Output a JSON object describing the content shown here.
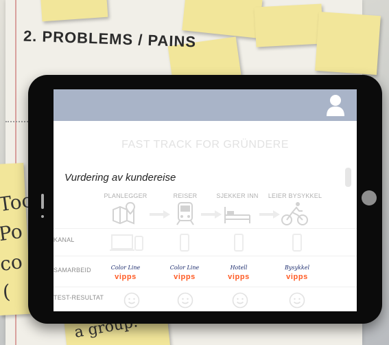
{
  "background": {
    "heading": "2. PROBLEMS / PAINS",
    "notes": [
      "Too",
      "Po",
      "co",
      "(",
      "a group."
    ]
  },
  "app": {
    "title": "FAST TRACK FOR GRÜNDERE",
    "user_icon": "user-icon",
    "section_title": "Vurdering av kundereise",
    "stages": [
      {
        "label": "PLANLEGGER",
        "icon": "map-icon"
      },
      {
        "label": "REISER",
        "icon": "train-icon"
      },
      {
        "label": "SJEKKER INN",
        "icon": "bed-icon"
      },
      {
        "label": "LEIER BYSYKKEL",
        "icon": "cyclist-icon"
      }
    ],
    "rows": {
      "kanal": "KANAL",
      "samarbeid": "SAMARBEID",
      "test_resultat": "TEST-RESULTAT"
    },
    "partners": [
      {
        "brand": "Color Line",
        "pay": "vipps"
      },
      {
        "brand": "Color Line",
        "pay": "vipps"
      },
      {
        "brand": "Hotell",
        "pay": "vipps"
      },
      {
        "brand": "Bysykkel",
        "pay": "vipps"
      }
    ],
    "colors": {
      "topbar": "#a9b4c8",
      "vipps": "#ff5b24",
      "faded": "#d2d2d2"
    }
  }
}
